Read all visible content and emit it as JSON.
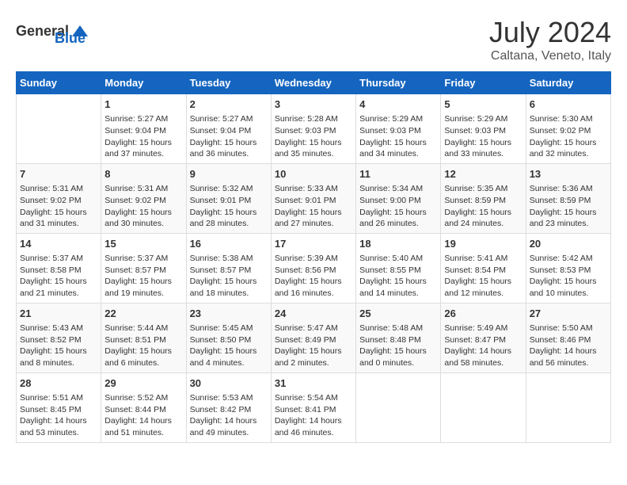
{
  "header": {
    "logo_general": "General",
    "logo_blue": "Blue",
    "title": "July 2024",
    "subtitle": "Caltana, Veneto, Italy"
  },
  "calendar": {
    "days_of_week": [
      "Sunday",
      "Monday",
      "Tuesday",
      "Wednesday",
      "Thursday",
      "Friday",
      "Saturday"
    ],
    "weeks": [
      [
        {
          "day": "",
          "content": ""
        },
        {
          "day": "1",
          "content": "Sunrise: 5:27 AM\nSunset: 9:04 PM\nDaylight: 15 hours\nand 37 minutes."
        },
        {
          "day": "2",
          "content": "Sunrise: 5:27 AM\nSunset: 9:04 PM\nDaylight: 15 hours\nand 36 minutes."
        },
        {
          "day": "3",
          "content": "Sunrise: 5:28 AM\nSunset: 9:03 PM\nDaylight: 15 hours\nand 35 minutes."
        },
        {
          "day": "4",
          "content": "Sunrise: 5:29 AM\nSunset: 9:03 PM\nDaylight: 15 hours\nand 34 minutes."
        },
        {
          "day": "5",
          "content": "Sunrise: 5:29 AM\nSunset: 9:03 PM\nDaylight: 15 hours\nand 33 minutes."
        },
        {
          "day": "6",
          "content": "Sunrise: 5:30 AM\nSunset: 9:02 PM\nDaylight: 15 hours\nand 32 minutes."
        }
      ],
      [
        {
          "day": "7",
          "content": "Sunrise: 5:31 AM\nSunset: 9:02 PM\nDaylight: 15 hours\nand 31 minutes."
        },
        {
          "day": "8",
          "content": "Sunrise: 5:31 AM\nSunset: 9:02 PM\nDaylight: 15 hours\nand 30 minutes."
        },
        {
          "day": "9",
          "content": "Sunrise: 5:32 AM\nSunset: 9:01 PM\nDaylight: 15 hours\nand 28 minutes."
        },
        {
          "day": "10",
          "content": "Sunrise: 5:33 AM\nSunset: 9:01 PM\nDaylight: 15 hours\nand 27 minutes."
        },
        {
          "day": "11",
          "content": "Sunrise: 5:34 AM\nSunset: 9:00 PM\nDaylight: 15 hours\nand 26 minutes."
        },
        {
          "day": "12",
          "content": "Sunrise: 5:35 AM\nSunset: 8:59 PM\nDaylight: 15 hours\nand 24 minutes."
        },
        {
          "day": "13",
          "content": "Sunrise: 5:36 AM\nSunset: 8:59 PM\nDaylight: 15 hours\nand 23 minutes."
        }
      ],
      [
        {
          "day": "14",
          "content": "Sunrise: 5:37 AM\nSunset: 8:58 PM\nDaylight: 15 hours\nand 21 minutes."
        },
        {
          "day": "15",
          "content": "Sunrise: 5:37 AM\nSunset: 8:57 PM\nDaylight: 15 hours\nand 19 minutes."
        },
        {
          "day": "16",
          "content": "Sunrise: 5:38 AM\nSunset: 8:57 PM\nDaylight: 15 hours\nand 18 minutes."
        },
        {
          "day": "17",
          "content": "Sunrise: 5:39 AM\nSunset: 8:56 PM\nDaylight: 15 hours\nand 16 minutes."
        },
        {
          "day": "18",
          "content": "Sunrise: 5:40 AM\nSunset: 8:55 PM\nDaylight: 15 hours\nand 14 minutes."
        },
        {
          "day": "19",
          "content": "Sunrise: 5:41 AM\nSunset: 8:54 PM\nDaylight: 15 hours\nand 12 minutes."
        },
        {
          "day": "20",
          "content": "Sunrise: 5:42 AM\nSunset: 8:53 PM\nDaylight: 15 hours\nand 10 minutes."
        }
      ],
      [
        {
          "day": "21",
          "content": "Sunrise: 5:43 AM\nSunset: 8:52 PM\nDaylight: 15 hours\nand 8 minutes."
        },
        {
          "day": "22",
          "content": "Sunrise: 5:44 AM\nSunset: 8:51 PM\nDaylight: 15 hours\nand 6 minutes."
        },
        {
          "day": "23",
          "content": "Sunrise: 5:45 AM\nSunset: 8:50 PM\nDaylight: 15 hours\nand 4 minutes."
        },
        {
          "day": "24",
          "content": "Sunrise: 5:47 AM\nSunset: 8:49 PM\nDaylight: 15 hours\nand 2 minutes."
        },
        {
          "day": "25",
          "content": "Sunrise: 5:48 AM\nSunset: 8:48 PM\nDaylight: 15 hours\nand 0 minutes."
        },
        {
          "day": "26",
          "content": "Sunrise: 5:49 AM\nSunset: 8:47 PM\nDaylight: 14 hours\nand 58 minutes."
        },
        {
          "day": "27",
          "content": "Sunrise: 5:50 AM\nSunset: 8:46 PM\nDaylight: 14 hours\nand 56 minutes."
        }
      ],
      [
        {
          "day": "28",
          "content": "Sunrise: 5:51 AM\nSunset: 8:45 PM\nDaylight: 14 hours\nand 53 minutes."
        },
        {
          "day": "29",
          "content": "Sunrise: 5:52 AM\nSunset: 8:44 PM\nDaylight: 14 hours\nand 51 minutes."
        },
        {
          "day": "30",
          "content": "Sunrise: 5:53 AM\nSunset: 8:42 PM\nDaylight: 14 hours\nand 49 minutes."
        },
        {
          "day": "31",
          "content": "Sunrise: 5:54 AM\nSunset: 8:41 PM\nDaylight: 14 hours\nand 46 minutes."
        },
        {
          "day": "",
          "content": ""
        },
        {
          "day": "",
          "content": ""
        },
        {
          "day": "",
          "content": ""
        }
      ]
    ]
  }
}
